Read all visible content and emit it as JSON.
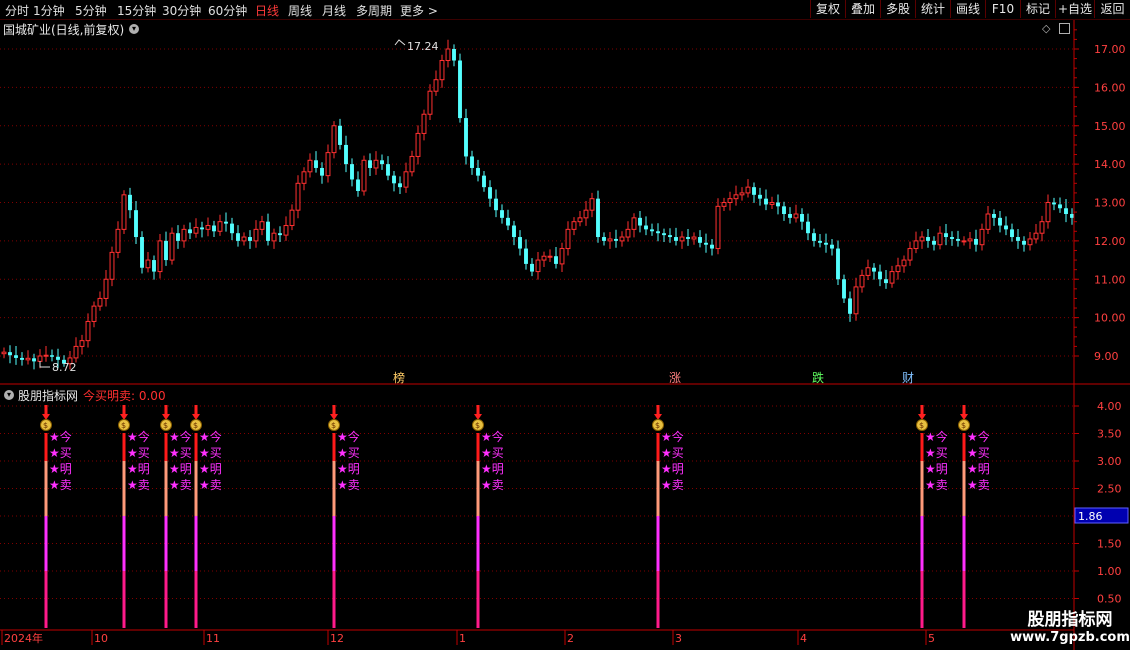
{
  "toolbar": {
    "timeframes": [
      "分时",
      "1分钟",
      "5分钟",
      "15分钟",
      "30分钟",
      "60分钟",
      "日线",
      "周线",
      "月线",
      "多周期",
      "更多 >"
    ],
    "active_timeframe": "日线",
    "buttons": [
      "复权",
      "叠加",
      "多股",
      "统计",
      "画线",
      "F10",
      "标记",
      "+自选",
      "返回"
    ]
  },
  "chart_header": {
    "title": "国城矿业(日线,前复权)"
  },
  "price_axis": {
    "ticks": [
      "17.00",
      "16.00",
      "15.00",
      "14.00",
      "13.00",
      "12.00",
      "11.00",
      "10.00",
      "9.00"
    ]
  },
  "annotations": {
    "high_label": "17.24",
    "low_label": "8.72"
  },
  "event_markers": [
    "榜",
    "涨",
    "跌",
    "财"
  ],
  "indicator": {
    "title": "股朋指标网",
    "value_label": "今买明卖: 0.00",
    "axis_ticks": [
      "4.00",
      "3.50",
      "3.00",
      "2.50",
      "2.00",
      "1.50",
      "1.00",
      "0.50"
    ],
    "current_value": "1.86",
    "signal_chars": [
      "★今",
      "★买",
      "★明",
      "★卖"
    ]
  },
  "date_axis": {
    "labels": [
      "2024年",
      "10",
      "11",
      "12",
      "1",
      "2",
      "3",
      "4",
      "5"
    ]
  },
  "colors": {
    "up": "#ff3030",
    "down": "#54ffff",
    "grid": "#800000",
    "signal_text": "#ff30ff"
  },
  "watermark": {
    "line1": "股朋指标网",
    "line2": "www.7gpzb.com"
  },
  "chart_data": {
    "type": "candlestick",
    "price_range": [
      8.5,
      17.5
    ],
    "high_value": 17.24,
    "low_value": 8.72,
    "closes": [
      9.1,
      9.02,
      8.95,
      8.9,
      8.94,
      8.86,
      9.0,
      9.02,
      8.98,
      8.9,
      8.8,
      8.95,
      9.25,
      9.4,
      9.9,
      10.3,
      10.5,
      11.0,
      11.7,
      12.3,
      13.2,
      12.8,
      12.1,
      11.3,
      11.5,
      11.2,
      12.0,
      11.5,
      12.2,
      12.0,
      12.3,
      12.2,
      12.35,
      12.3,
      12.4,
      12.25,
      12.5,
      12.45,
      12.2,
      12.0,
      12.1,
      12.0,
      12.3,
      12.5,
      12.0,
      12.2,
      12.15,
      12.4,
      12.8,
      13.5,
      13.8,
      14.1,
      13.9,
      13.7,
      14.3,
      15.0,
      14.5,
      14.0,
      13.6,
      13.3,
      14.1,
      13.9,
      14.1,
      14.0,
      13.7,
      13.5,
      13.4,
      13.8,
      14.2,
      14.8,
      15.3,
      15.9,
      16.2,
      16.7,
      17.0,
      16.7,
      15.2,
      14.2,
      13.9,
      13.7,
      13.4,
      13.1,
      12.8,
      12.6,
      12.4,
      12.1,
      11.8,
      11.4,
      11.2,
      11.5,
      11.6,
      11.6,
      11.4,
      11.8,
      12.3,
      12.5,
      12.6,
      12.8,
      13.1,
      12.1,
      12.0,
      12.05,
      12.0,
      12.1,
      12.3,
      12.6,
      12.4,
      12.3,
      12.25,
      12.2,
      12.15,
      12.1,
      12.0,
      12.1,
      12.05,
      12.1,
      11.95,
      11.9,
      11.8,
      12.9,
      13.0,
      13.1,
      13.2,
      13.25,
      13.4,
      13.2,
      13.1,
      12.95,
      13.0,
      12.9,
      12.7,
      12.6,
      12.7,
      12.5,
      12.2,
      12.0,
      11.95,
      11.9,
      11.8,
      11.0,
      10.5,
      10.1,
      10.8,
      11.1,
      11.3,
      11.2,
      11.0,
      10.9,
      11.2,
      11.35,
      11.5,
      11.8,
      12.0,
      12.1,
      12.0,
      11.9,
      12.2,
      12.1,
      12.05,
      12.0,
      12.0,
      12.05,
      11.9,
      12.3,
      12.7,
      12.6,
      12.4,
      12.3,
      12.1,
      12.0,
      11.9,
      12.05,
      12.2,
      12.5,
      13.0,
      12.95,
      12.85,
      12.7,
      12.6
    ],
    "buy_signal_indices": [
      7,
      20,
      27,
      32,
      55,
      79,
      109,
      153,
      160
    ],
    "signal_range": [
      0,
      4.3
    ]
  }
}
